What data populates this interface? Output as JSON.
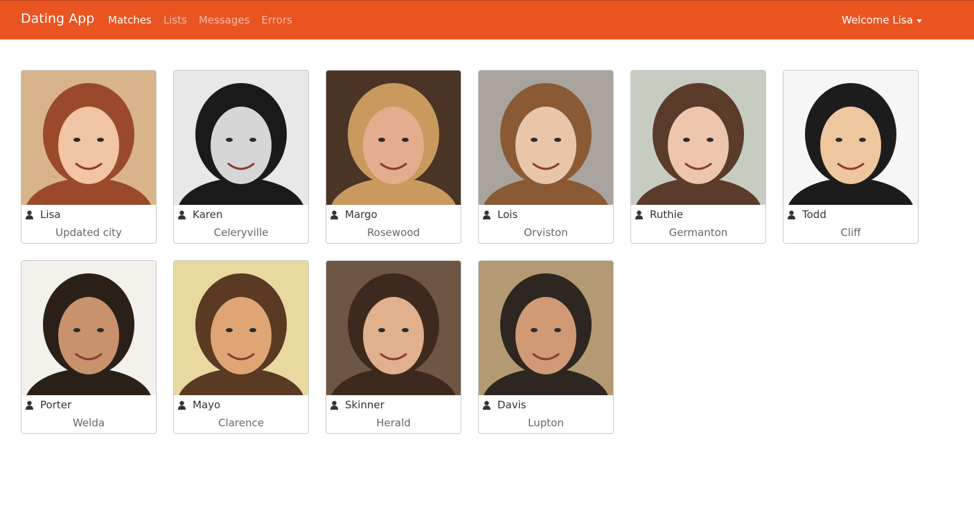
{
  "nav": {
    "brand": "Dating App",
    "links": [
      {
        "label": "Matches",
        "active": true
      },
      {
        "label": "Lists",
        "active": false
      },
      {
        "label": "Messages",
        "active": false
      },
      {
        "label": "Errors",
        "active": false
      }
    ],
    "welcome": "Welcome Lisa",
    "accent_color": "#e95420"
  },
  "members": [
    {
      "name": "Lisa",
      "city": "Updated city",
      "photo": "woman-curly-red-hair",
      "bg": "#d9b48a",
      "skin": "#f1c4a3",
      "hair": "#9a4a2a"
    },
    {
      "name": "Karen",
      "city": "Celeryville",
      "photo": "woman-beanie-glasses",
      "bg": "#e8e8e8",
      "skin": "#d6d6d6",
      "hair": "#1a1a1a"
    },
    {
      "name": "Margo",
      "city": "Rosewood",
      "photo": "woman-blonde-bob",
      "bg": "#4a3426",
      "skin": "#e3ad8e",
      "hair": "#c99a5e"
    },
    {
      "name": "Lois",
      "city": "Orviston",
      "photo": "woman-long-brown-hair",
      "bg": "#a9a39d",
      "skin": "#e9c6aa",
      "hair": "#8a5a34"
    },
    {
      "name": "Ruthie",
      "city": "Germanton",
      "photo": "woman-pink-jacket",
      "bg": "#c6cdc0",
      "skin": "#edc6ad",
      "hair": "#5b3b2a"
    },
    {
      "name": "Todd",
      "city": "Cliff",
      "photo": "man-short-black-hair",
      "bg": "#f6f6f6",
      "skin": "#efc79f",
      "hair": "#1c1c1c"
    },
    {
      "name": "Porter",
      "city": "Welda",
      "photo": "man-shaved-head",
      "bg": "#f4f1ec",
      "skin": "#c8926c",
      "hair": "#2a2018"
    },
    {
      "name": "Mayo",
      "city": "Clarence",
      "photo": "man-styled-hair",
      "bg": "#e7d9a0",
      "skin": "#dfa575",
      "hair": "#5a3a22"
    },
    {
      "name": "Skinner",
      "city": "Herald",
      "photo": "man-beard-wood-wall",
      "bg": "#6e5644",
      "skin": "#e1b08c",
      "hair": "#3d2a1e"
    },
    {
      "name": "Davis",
      "city": "Lupton",
      "photo": "man-hand-gesture",
      "bg": "#b39a72",
      "skin": "#cf9a74",
      "hair": "#2e2620"
    }
  ]
}
